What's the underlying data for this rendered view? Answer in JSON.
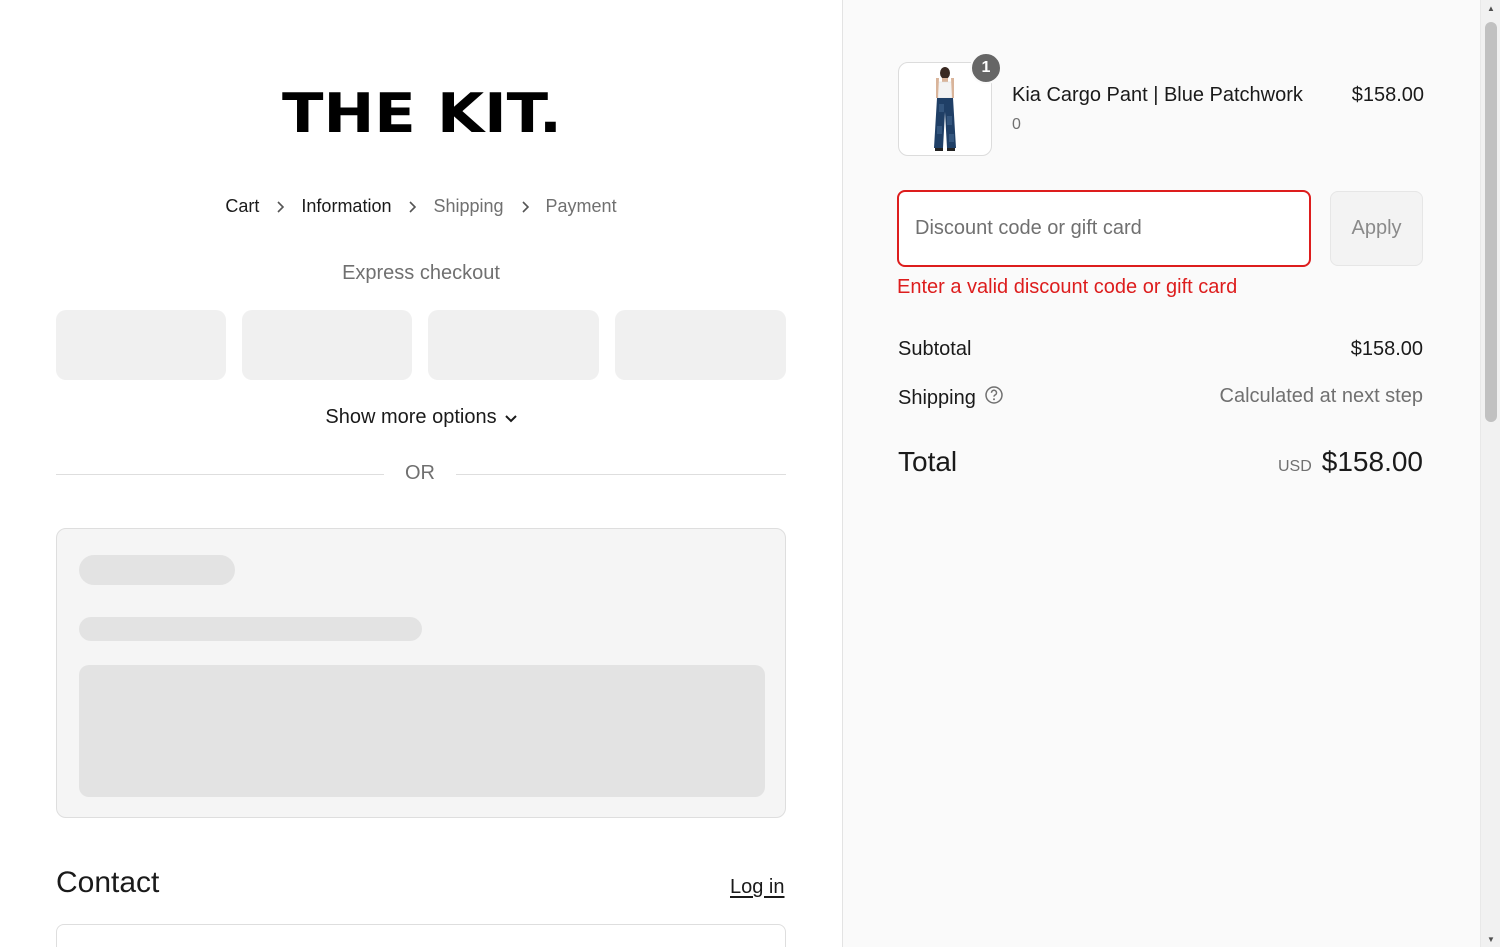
{
  "store": {
    "logo_text": "THE KIT."
  },
  "breadcrumb": {
    "items": [
      {
        "label": "Cart",
        "state": "link"
      },
      {
        "label": "Information",
        "state": "current"
      },
      {
        "label": "Shipping",
        "state": "upcoming"
      },
      {
        "label": "Payment",
        "state": "upcoming"
      }
    ]
  },
  "express": {
    "title": "Express checkout",
    "show_more": "Show more options",
    "divider": "OR"
  },
  "contact": {
    "title": "Contact",
    "login_link": "Log in"
  },
  "order": {
    "item": {
      "name": "Kia Cargo Pant | Blue Patchwork",
      "variant": "0",
      "price": "$158.00",
      "quantity": "1"
    },
    "discount": {
      "placeholder": "Discount code or gift card",
      "value": "",
      "apply_label": "Apply",
      "error": "Enter a valid discount code or gift card"
    },
    "subtotal": {
      "label": "Subtotal",
      "value": "$158.00"
    },
    "shipping": {
      "label": "Shipping",
      "value": "Calculated at next step"
    },
    "total": {
      "label": "Total",
      "currency": "USD",
      "value": "$158.00"
    }
  },
  "colors": {
    "error": "#dd1d1d",
    "muted_text": "#707070",
    "skeleton": "#e3e3e3",
    "panel_bg": "#fafafa"
  }
}
